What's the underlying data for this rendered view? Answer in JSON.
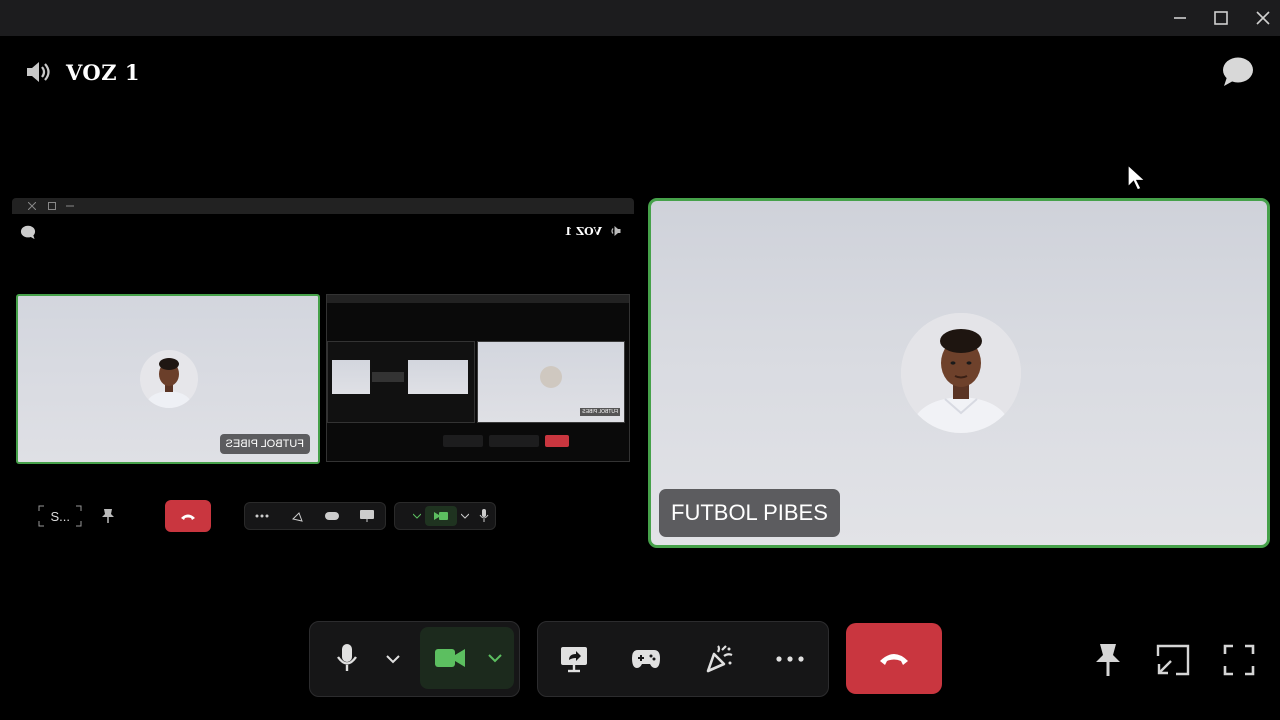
{
  "window": {
    "minimize_icon": "minimize-icon",
    "maximize_icon": "maximize-icon",
    "close_icon": "close-icon"
  },
  "channel": {
    "name": "VOZ 1",
    "icon": "speaker-icon"
  },
  "chat_button": {
    "icon": "chat-bubble-icon"
  },
  "share_tile": {
    "description_hidden": true,
    "mirrored_labels": {
      "channel_name": "VOZ 1",
      "participant_label": "FUTBOL PIBES",
      "truncated_label": "S...",
      "nested_participant_label": "FUTBOL PIBES"
    }
  },
  "main_tile": {
    "participant_label": "FUTBOL PIBES",
    "border_color": "#46a14a"
  },
  "controls": {
    "microphone_icon": "microphone-icon",
    "mic_dropdown_icon": "chevron-down-icon",
    "camera_icon": "camera-icon",
    "camera_dropdown_icon": "chevron-down-icon",
    "screen_share_icon": "screen-share-icon",
    "activities_icon": "gamepad-icon",
    "soundboard_icon": "soundboard-icon",
    "more_icon": "more-icon",
    "hangup_icon": "phone-hangup-icon",
    "pin_icon": "pin-icon",
    "popout_icon": "popout-icon",
    "fullscreen_icon": "fullscreen-icon"
  },
  "colors": {
    "camera_active": "#5cbf60",
    "hangup": "#c9363f",
    "tile_border": "#46a14a"
  }
}
